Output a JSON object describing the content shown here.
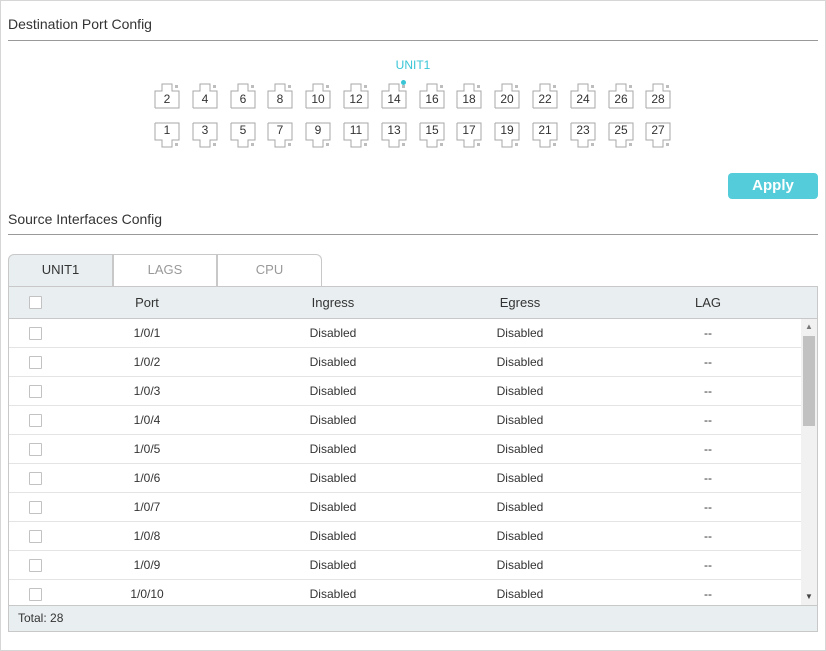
{
  "destination": {
    "title": "Destination Port Config",
    "unit_label": "UNIT1",
    "ports_top": [
      "2",
      "4",
      "6",
      "8",
      "10",
      "12",
      "14",
      "16",
      "18",
      "20",
      "22",
      "24",
      "26",
      "28"
    ],
    "ports_bottom": [
      "1",
      "3",
      "5",
      "7",
      "9",
      "11",
      "13",
      "15",
      "17",
      "19",
      "21",
      "23",
      "25",
      "27"
    ],
    "selected_port": "14",
    "apply_label": "Apply"
  },
  "source": {
    "title": "Source Interfaces Config",
    "tabs": [
      "UNIT1",
      "LAGS",
      "CPU"
    ],
    "active_tab": "UNIT1",
    "columns": [
      "Port",
      "Ingress",
      "Egress",
      "LAG"
    ],
    "rows": [
      {
        "port": "1/0/1",
        "ingress": "Disabled",
        "egress": "Disabled",
        "lag": "--"
      },
      {
        "port": "1/0/2",
        "ingress": "Disabled",
        "egress": "Disabled",
        "lag": "--"
      },
      {
        "port": "1/0/3",
        "ingress": "Disabled",
        "egress": "Disabled",
        "lag": "--"
      },
      {
        "port": "1/0/4",
        "ingress": "Disabled",
        "egress": "Disabled",
        "lag": "--"
      },
      {
        "port": "1/0/5",
        "ingress": "Disabled",
        "egress": "Disabled",
        "lag": "--"
      },
      {
        "port": "1/0/6",
        "ingress": "Disabled",
        "egress": "Disabled",
        "lag": "--"
      },
      {
        "port": "1/0/7",
        "ingress": "Disabled",
        "egress": "Disabled",
        "lag": "--"
      },
      {
        "port": "1/0/8",
        "ingress": "Disabled",
        "egress": "Disabled",
        "lag": "--"
      },
      {
        "port": "1/0/9",
        "ingress": "Disabled",
        "egress": "Disabled",
        "lag": "--"
      },
      {
        "port": "1/0/10",
        "ingress": "Disabled",
        "egress": "Disabled",
        "lag": "--"
      }
    ],
    "total_label": "Total: 28"
  },
  "colors": {
    "accent": "#39c5d6",
    "button": "#54ccd9",
    "header_bg": "#e9eef0"
  },
  "icons": {
    "port": "port-icon",
    "scroll_up": "scroll-up-icon",
    "scroll_down": "scroll-down-icon"
  }
}
